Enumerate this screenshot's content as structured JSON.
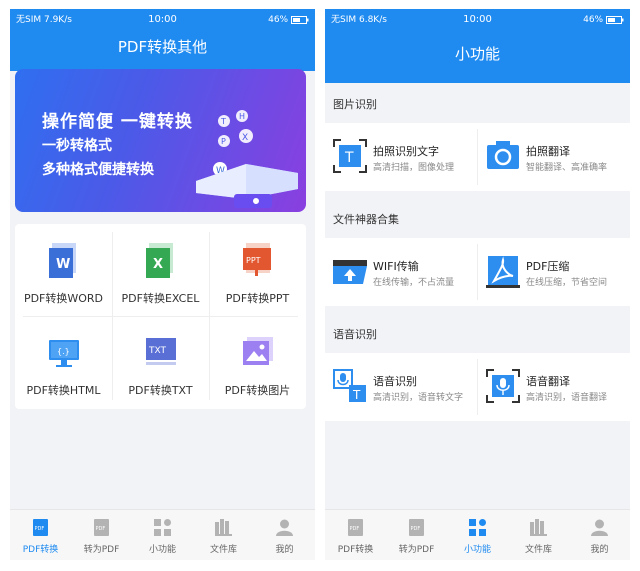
{
  "screen1": {
    "status": {
      "left": "无SIM 7.9K/s",
      "time": "10:00",
      "battery": "46%"
    },
    "title": "PDF转换其他",
    "banner": {
      "line1": "操作简便   一键转换",
      "line2": "一秒转格式",
      "line3": "多种格式便捷转换"
    },
    "tools": [
      {
        "label": "PDF转换WORD",
        "icon": "word-file-icon",
        "badge": "W",
        "color": "#3b6fd8"
      },
      {
        "label": "PDF转换EXCEL",
        "icon": "excel-file-icon",
        "badge": "X",
        "color": "#34a853"
      },
      {
        "label": "PDF转换PPT",
        "icon": "ppt-file-icon",
        "badge": "PPT",
        "color": "#e2572f"
      },
      {
        "label": "PDF转换HTML",
        "icon": "html-monitor-icon",
        "badge": "{.}",
        "color": "#2d8ef0"
      },
      {
        "label": "PDF转换TXT",
        "icon": "txt-file-icon",
        "badge": "TXT",
        "color": "#5a6fd6"
      },
      {
        "label": "PDF转换图片",
        "icon": "image-file-icon",
        "badge": "",
        "color": "#9c7ff0"
      }
    ],
    "tabs": [
      {
        "label": "PDF转换",
        "icon": "pdf-convert-icon",
        "active": true
      },
      {
        "label": "转为PDF",
        "icon": "to-pdf-icon",
        "active": false
      },
      {
        "label": "小功能",
        "icon": "widgets-icon",
        "active": false
      },
      {
        "label": "文件库",
        "icon": "library-icon",
        "active": false
      },
      {
        "label": "我的",
        "icon": "profile-icon",
        "active": false
      }
    ]
  },
  "screen2": {
    "status": {
      "left": "无SIM 6.8K/s",
      "time": "10:00",
      "battery": "46%"
    },
    "title": "小功能",
    "sections": [
      {
        "title": "图片识别",
        "items": [
          {
            "name": "拍照识别文字",
            "desc": "高清扫描，图像处理",
            "icon": "scan-text-icon"
          },
          {
            "name": "拍照翻译",
            "desc": "智能翻译、高准确率",
            "icon": "camera-translate-icon"
          }
        ]
      },
      {
        "title": "文件神器合集",
        "items": [
          {
            "name": "WIFI传输",
            "desc": "在线传输，不占流量",
            "icon": "wifi-transfer-icon"
          },
          {
            "name": "PDF压缩",
            "desc": "在线压缩，节省空间",
            "icon": "pdf-compress-icon"
          }
        ]
      },
      {
        "title": "语音识别",
        "items": [
          {
            "name": "语音识别",
            "desc": "高清识别，语音转文字",
            "icon": "speech-to-text-icon"
          },
          {
            "name": "语音翻译",
            "desc": "高清识别，语音翻译",
            "icon": "voice-translate-icon"
          }
        ]
      }
    ],
    "tabs": [
      {
        "label": "PDF转换",
        "icon": "pdf-convert-icon",
        "active": false
      },
      {
        "label": "转为PDF",
        "icon": "to-pdf-icon",
        "active": false
      },
      {
        "label": "小功能",
        "icon": "widgets-icon",
        "active": true
      },
      {
        "label": "文件库",
        "icon": "library-icon",
        "active": false
      },
      {
        "label": "我的",
        "icon": "profile-icon",
        "active": false
      }
    ]
  },
  "colors": {
    "primary": "#1f8bf0",
    "background": "#f2f3f7"
  }
}
